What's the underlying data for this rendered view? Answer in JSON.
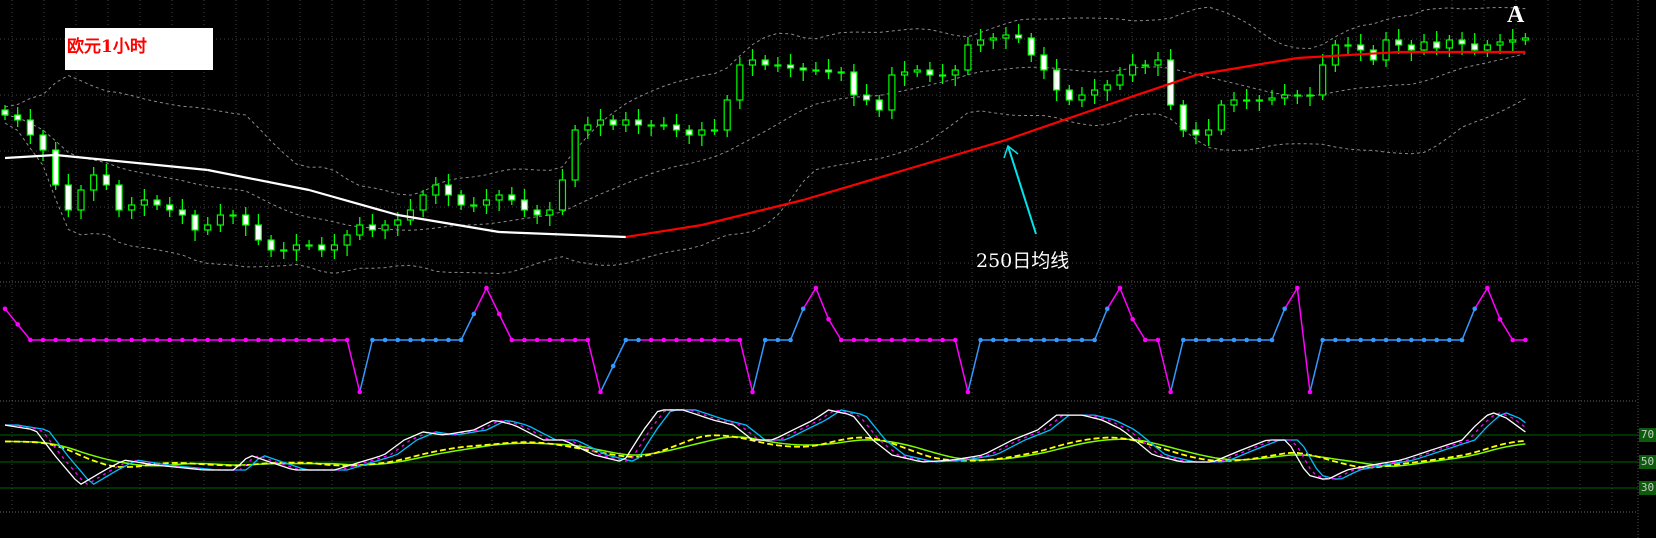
{
  "annotations": {
    "title": "欧元1小时",
    "marker": "A",
    "ma_label": "250日均线"
  },
  "colors": {
    "background": "#000000",
    "candle": "#00ff00",
    "ma_falling": "#ffffff",
    "ma_rising": "#ff0000",
    "bands": "#8a8a8a",
    "osc_down": "#ff00ff",
    "osc_up": "#3399ff",
    "arrow": "#00e5ee",
    "stoch_main": "#ffffff",
    "stoch_signal": "#00bfff",
    "stoch_dash": "#ff00ff",
    "stoch_slow": "#ffff00",
    "stoch_slow2": "#7cfc00",
    "level_line": "#006400"
  },
  "chart_data": [
    {
      "type": "candlestick",
      "title": "欧元1小时",
      "ylim": [
        1.31,
        1.338
      ],
      "close": [
        1.3265,
        1.326,
        1.3245,
        1.323,
        1.3195,
        1.317,
        1.319,
        1.3205,
        1.3195,
        1.317,
        1.3175,
        1.318,
        1.3175,
        1.317,
        1.3165,
        1.315,
        1.3155,
        1.3165,
        1.3165,
        1.3155,
        1.314,
        1.313,
        1.313,
        1.3135,
        1.3135,
        1.313,
        1.3135,
        1.3145,
        1.3155,
        1.315,
        1.3155,
        1.316,
        1.317,
        1.3185,
        1.3195,
        1.3185,
        1.3175,
        1.3175,
        1.318,
        1.3185,
        1.318,
        1.317,
        1.3165,
        1.317,
        1.32,
        1.325,
        1.3255,
        1.326,
        1.3255,
        1.326,
        1.3255,
        1.3255,
        1.3255,
        1.325,
        1.3245,
        1.325,
        1.325,
        1.328,
        1.3315,
        1.332,
        1.3315,
        1.3315,
        1.3312,
        1.331,
        1.331,
        1.3308,
        1.3308,
        1.3285,
        1.328,
        1.327,
        1.3305,
        1.3308,
        1.331,
        1.3305,
        1.3305,
        1.331,
        1.3335,
        1.334,
        1.3342,
        1.3345,
        1.3342,
        1.3325,
        1.331,
        1.329,
        1.328,
        1.3285,
        1.329,
        1.3295,
        1.3305,
        1.3315,
        1.3315,
        1.332,
        1.3275,
        1.325,
        1.3245,
        1.325,
        1.3275,
        1.328,
        1.328,
        1.328,
        1.3282,
        1.3285,
        1.3285,
        1.3285,
        1.3315,
        1.3335,
        1.3335,
        1.333,
        1.332,
        1.334,
        1.3335,
        1.333,
        1.3338,
        1.3332,
        1.334,
        1.3336,
        1.333,
        1.3335,
        1.3338,
        1.334,
        1.3342
      ],
      "ma250": [
        [
          0,
          1.3222
        ],
        [
          4,
          1.3225
        ],
        [
          16,
          1.321
        ],
        [
          24,
          1.319
        ],
        [
          31,
          1.3165
        ],
        [
          39,
          1.3148
        ],
        [
          49,
          1.3143
        ],
        [
          55,
          1.3155
        ],
        [
          63,
          1.318
        ],
        [
          71,
          1.321
        ],
        [
          79,
          1.324
        ],
        [
          87,
          1.3275
        ],
        [
          94,
          1.3305
        ],
        [
          102,
          1.3322
        ],
        [
          110,
          1.3328
        ],
        [
          120,
          1.3328
        ]
      ],
      "ma250_rising_from_bar": 49,
      "bollinger_period": 20
    },
    {
      "type": "line",
      "name": "oscillator",
      "ylim": [
        -100,
        100
      ],
      "points": [
        [
          0,
          60,
          "d"
        ],
        [
          1,
          30,
          "d"
        ],
        [
          2,
          0,
          "d"
        ],
        [
          27,
          0,
          "d"
        ],
        [
          28,
          -100,
          "d"
        ],
        [
          29,
          0,
          "u"
        ],
        [
          36,
          0,
          "u"
        ],
        [
          37,
          50,
          "u"
        ],
        [
          38,
          100,
          "d"
        ],
        [
          39,
          50,
          "d"
        ],
        [
          40,
          0,
          "d"
        ],
        [
          46,
          0,
          "d"
        ],
        [
          47,
          -100,
          "d"
        ],
        [
          48,
          -50,
          "u"
        ],
        [
          49,
          0,
          "u"
        ],
        [
          50,
          0,
          "u"
        ],
        [
          51,
          0,
          "d"
        ],
        [
          58,
          0,
          "d"
        ],
        [
          59,
          -100,
          "d"
        ],
        [
          60,
          0,
          "u"
        ],
        [
          62,
          0,
          "u"
        ],
        [
          63,
          60,
          "u"
        ],
        [
          64,
          100,
          "d"
        ],
        [
          65,
          40,
          "d"
        ],
        [
          66,
          0,
          "d"
        ],
        [
          75,
          0,
          "d"
        ],
        [
          76,
          -100,
          "d"
        ],
        [
          77,
          0,
          "u"
        ],
        [
          86,
          0,
          "u"
        ],
        [
          87,
          60,
          "u"
        ],
        [
          88,
          100,
          "d"
        ],
        [
          89,
          40,
          "d"
        ],
        [
          90,
          0,
          "d"
        ],
        [
          91,
          0,
          "d"
        ],
        [
          92,
          -100,
          "d"
        ],
        [
          93,
          0,
          "u"
        ],
        [
          100,
          0,
          "u"
        ],
        [
          101,
          60,
          "u"
        ],
        [
          102,
          100,
          "d"
        ],
        [
          103,
          -100,
          "d"
        ],
        [
          104,
          0,
          "u"
        ],
        [
          115,
          0,
          "u"
        ],
        [
          116,
          60,
          "u"
        ],
        [
          117,
          100,
          "d"
        ],
        [
          118,
          40,
          "d"
        ],
        [
          119,
          0,
          "d"
        ],
        [
          120,
          0,
          "d"
        ]
      ]
    },
    {
      "type": "line",
      "name": "stochastic",
      "ylim": [
        0,
        100
      ],
      "levels": [
        "70",
        "50",
        "30"
      ],
      "main": [
        [
          0,
          77.5
        ],
        [
          2.4,
          73.8
        ],
        [
          3.9,
          54.9
        ],
        [
          5.9,
          32.3
        ],
        [
          7.9,
          43.6
        ],
        [
          9.4,
          51.1
        ],
        [
          11.8,
          47.4
        ],
        [
          15.7,
          43.6
        ],
        [
          18.1,
          43.6
        ],
        [
          19.3,
          54.9
        ],
        [
          20.9,
          49.6
        ],
        [
          22.8,
          43.6
        ],
        [
          26,
          43.6
        ],
        [
          29.9,
          54.9
        ],
        [
          31.5,
          66.2
        ],
        [
          33,
          72.3
        ],
        [
          34.6,
          70
        ],
        [
          37,
          73.8
        ],
        [
          38.6,
          81.3
        ],
        [
          40.2,
          77.5
        ],
        [
          42.5,
          66.2
        ],
        [
          44.1,
          66.2
        ],
        [
          46.5,
          54.9
        ],
        [
          48.8,
          49.6
        ],
        [
          50.4,
          73.8
        ],
        [
          51.6,
          88.9
        ],
        [
          53.5,
          88.9
        ],
        [
          55.9,
          81.3
        ],
        [
          57.5,
          77.5
        ],
        [
          59,
          66.2
        ],
        [
          60.6,
          66.2
        ],
        [
          62.2,
          73.8
        ],
        [
          63.8,
          81.3
        ],
        [
          65,
          88.9
        ],
        [
          66.9,
          85
        ],
        [
          68.5,
          66.2
        ],
        [
          70,
          54.9
        ],
        [
          72.4,
          49.6
        ],
        [
          74.8,
          51.1
        ],
        [
          77.2,
          54.9
        ],
        [
          79.5,
          66.2
        ],
        [
          81.5,
          73.8
        ],
        [
          83,
          85
        ],
        [
          85,
          85
        ],
        [
          86.6,
          81.3
        ],
        [
          88.2,
          73.8
        ],
        [
          90.6,
          54.9
        ],
        [
          92.9,
          49.6
        ],
        [
          95.3,
          49.6
        ],
        [
          97.6,
          58.7
        ],
        [
          99.6,
          66.2
        ],
        [
          101.2,
          66.2
        ],
        [
          102.8,
          39.8
        ],
        [
          104.3,
          36
        ],
        [
          105.9,
          43.6
        ],
        [
          107.9,
          47.4
        ],
        [
          110.2,
          51.1
        ],
        [
          112.6,
          58.7
        ],
        [
          115,
          66.2
        ],
        [
          116.1,
          77.5
        ],
        [
          117.3,
          87.4
        ],
        [
          118.5,
          82.8
        ],
        [
          120,
          72.3
        ]
      ]
    }
  ]
}
